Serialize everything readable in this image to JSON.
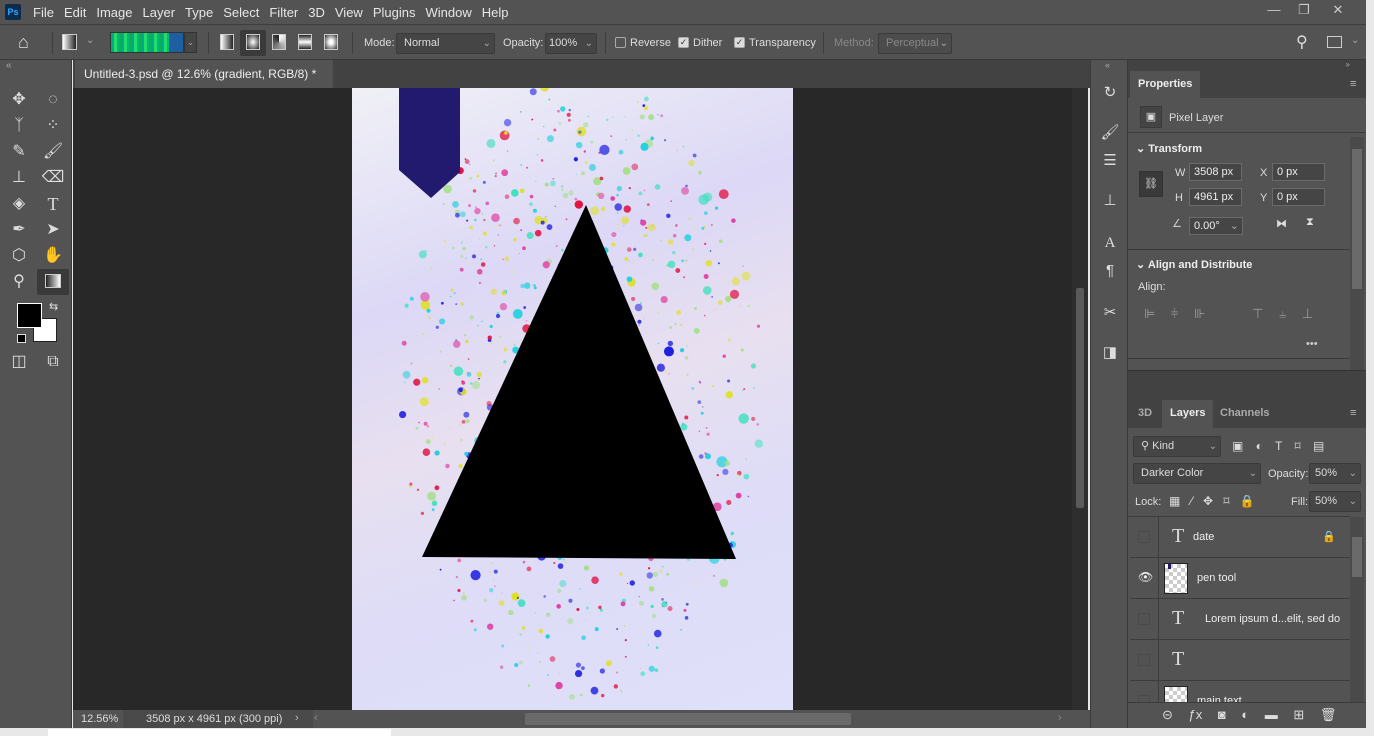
{
  "app": {
    "logo": "Ps"
  },
  "menu": [
    "File",
    "Edit",
    "Image",
    "Layer",
    "Type",
    "Select",
    "Filter",
    "3D",
    "View",
    "Plugins",
    "Window",
    "Help"
  ],
  "window_controls": {
    "minimize": "—",
    "restore": "❐",
    "close": "✕"
  },
  "options": {
    "mode_label": "Mode:",
    "mode_value": "Normal",
    "opacity_label": "Opacity:",
    "opacity_value": "100%",
    "reverse_label": "Reverse",
    "reverse_checked": false,
    "dither_label": "Dither",
    "dither_checked": true,
    "transparency_label": "Transparency",
    "transparency_checked": true,
    "method_label": "Method:",
    "method_value": "Perceptual"
  },
  "document": {
    "tab_title": "Untitled-3.psd @ 12.6% (gradient, RGB/8) *",
    "close": "×"
  },
  "status": {
    "zoom": "12.56%",
    "info": "3508 px x 4961 px (300 ppi)"
  },
  "colors": {
    "foreground": "#000000",
    "background": "#ffffff",
    "banner": "#221a6e"
  },
  "properties": {
    "tab": "Properties",
    "layer_type": "Pixel Layer",
    "transform": {
      "title": "Transform",
      "w_label": "W",
      "w": "3508 px",
      "h_label": "H",
      "h": "4961 px",
      "x_label": "X",
      "x": "0 px",
      "y_label": "Y",
      "y": "0 px",
      "angle": "0.00°"
    },
    "align": {
      "title": "Align and Distribute",
      "label": "Align:",
      "more": "•••"
    }
  },
  "layers_panel": {
    "tabs": [
      "3D",
      "Layers",
      "Channels"
    ],
    "active_tab": "Layers",
    "filter": "Kind",
    "blend_mode": "Darker Color",
    "opacity_label": "Opacity:",
    "opacity": "50%",
    "lock_label": "Lock:",
    "fill_label": "Fill:",
    "fill": "50%",
    "layers": [
      {
        "name": "date",
        "type": "text",
        "visible": false,
        "locked": true
      },
      {
        "name": "pen tool",
        "type": "pixel",
        "visible": true,
        "locked": false
      },
      {
        "name": "Lorem ipsum d...elit, sed do",
        "type": "text",
        "visible": false,
        "locked": false
      },
      {
        "name": "",
        "type": "text",
        "visible": false,
        "locked": false
      },
      {
        "name": "main text",
        "type": "pixel",
        "visible": false,
        "locked": false
      }
    ]
  }
}
